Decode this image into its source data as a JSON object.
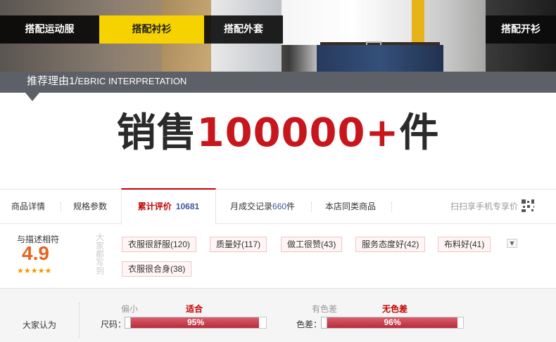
{
  "banner": {
    "tabs": [
      "搭配运动服",
      "搭配衬衫",
      "搭配外套",
      "搭配开衫"
    ],
    "active_tab_color": "#f5d200"
  },
  "reason": {
    "title": "推荐理由1/",
    "subtitle": "EBRIC INTERPRETATION"
  },
  "headline": {
    "prefix": "销售",
    "number": "100000+",
    "suffix": "件",
    "accent_color": "#c8161d"
  },
  "detail_tabs": {
    "items": [
      "商品详情",
      "规格参数",
      "累计评价",
      "月成交记录",
      "本店同类商品"
    ],
    "review_count": "10681",
    "monthly_count": "660",
    "monthly_unit": "件",
    "mobile_price": "扫扫享手机专享价",
    "qr_icon": "qr-code-icon"
  },
  "rating": {
    "label": "与描述相符",
    "score": "4.9",
    "stars": "★★★★★",
    "impression_label": "大家都写到",
    "tags": [
      "衣服很舒服(120)",
      "质量好(117)",
      "做工很赞(43)",
      "服务态度好(42)",
      "布料好(41)",
      "衣服很合身(38)"
    ],
    "expand_icon": "chevron-down-icon"
  },
  "fit": {
    "title": "大家认为",
    "size": {
      "label": "尺码：",
      "left": "偏小",
      "right": "适合",
      "percent_text": "95%",
      "percent": 0.95
    },
    "color": {
      "label": "色差：",
      "left": "有色差",
      "right": "无色差",
      "percent_text": "96%",
      "percent": 0.96
    }
  }
}
